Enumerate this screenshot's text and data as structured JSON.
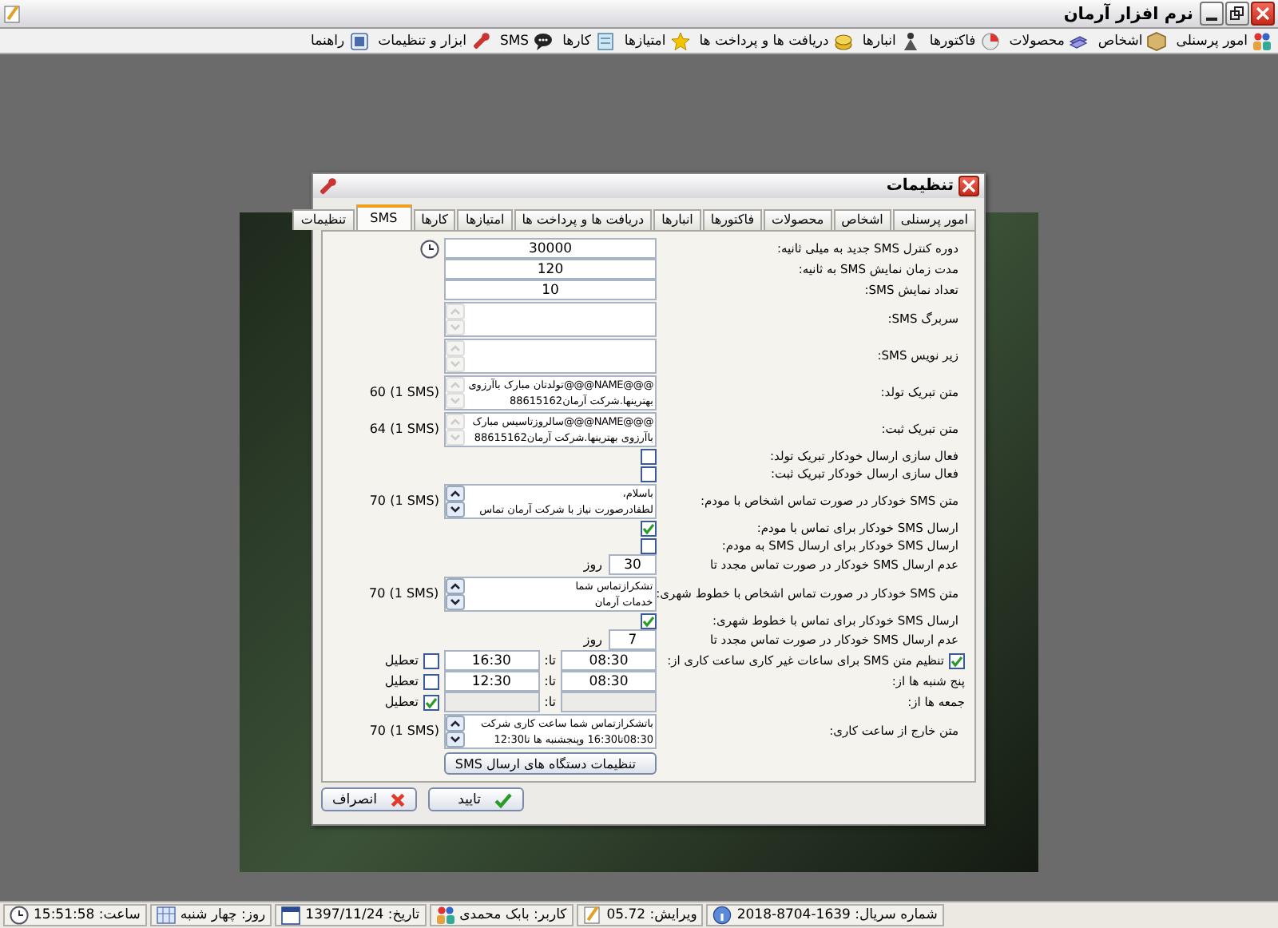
{
  "window": {
    "title": "نرم افزار آرمان"
  },
  "menu": [
    {
      "label": "امور پرسنلی"
    },
    {
      "label": "اشخاص"
    },
    {
      "label": "محصولات"
    },
    {
      "label": "فاکتورها"
    },
    {
      "label": "انبارها"
    },
    {
      "label": "دریافت ها و پرداخت ها"
    },
    {
      "label": "امتیازها"
    },
    {
      "label": "کارها"
    },
    {
      "label": "SMS"
    },
    {
      "label": "ابزار و تنظیمات"
    },
    {
      "label": "راهنما"
    }
  ],
  "dialog": {
    "title": "تنظیمات",
    "tabs": [
      {
        "label": "امور پرسنلی",
        "selected": false
      },
      {
        "label": "اشخاص",
        "selected": false
      },
      {
        "label": "محصولات",
        "selected": false
      },
      {
        "label": "فاکتورها",
        "selected": false
      },
      {
        "label": "انبارها",
        "selected": false
      },
      {
        "label": "دریافت ها و پرداخت ها",
        "selected": false
      },
      {
        "label": "امتیازها",
        "selected": false
      },
      {
        "label": "کارها",
        "selected": false
      },
      {
        "label": "SMS",
        "selected": true
      },
      {
        "label": "تنظیمات",
        "selected": false
      }
    ],
    "rows": [
      {
        "kind": "timer",
        "label": "دوره کنترل SMS جدید به میلی ثانیه:",
        "value": "30000"
      },
      {
        "kind": "number",
        "label": "مدت زمان نمایش SMS به ثانیه:",
        "value": "120"
      },
      {
        "kind": "number",
        "label": "تعداد نمایش SMS:",
        "value": "10"
      },
      {
        "kind": "memo",
        "label": "سربرگ SMS:",
        "lines": [],
        "scrollable": false
      },
      {
        "kind": "memo",
        "label": "زیر نویس SMS:",
        "lines": [],
        "scrollable": false
      },
      {
        "kind": "memo",
        "label": "متن تبریک تولد:",
        "lines": [
          "@@@NAME@@@تولدتان مبارک باآرزوی",
          "بهترینها.شرکت آرمان88615162"
        ],
        "count": "60 (1 SMS)",
        "scrollable": false
      },
      {
        "kind": "memo",
        "label": "متن تبریک ثبت:",
        "lines": [
          "@@@NAME@@@سالروزتاسیس مبارک",
          "باآرزوی بهترینها.شرکت آرمان88615162"
        ],
        "count": "64 (1 SMS)",
        "scrollable": false
      },
      {
        "kind": "check",
        "label": "فعال سازی ارسال خودکار تبریک تولد:",
        "checked": false
      },
      {
        "kind": "check",
        "label": "فعال سازی ارسال خودکار تبریک ثبت:",
        "checked": false
      },
      {
        "kind": "memo",
        "label": "متن SMS خودکار در صورت تماس اشخاص با مودم:",
        "lines": [
          "باسلام،",
          "لطفادرصورت نیاز با شرکت آرمان تماس"
        ],
        "count": "70 (1 SMS)",
        "scrollable": true
      },
      {
        "kind": "check",
        "label": "ارسال SMS خودکار برای تماس با مودم:",
        "checked": true
      },
      {
        "kind": "check",
        "label": "ارسال SMS خودکار برای ارسال SMS به مودم:",
        "checked": false
      },
      {
        "kind": "days",
        "label": "عدم ارسال SMS خودکار در صورت تماس مجدد تا",
        "value": "30",
        "unit": "روز"
      },
      {
        "kind": "memo",
        "label": "متن SMS خودکار در صورت تماس اشخاص با خطوط شهری:",
        "lines": [
          "تشکرازتماس شما",
          "خدمات آرمان"
        ],
        "count": "70 (1 SMS)",
        "scrollable": true
      },
      {
        "kind": "check",
        "label": "ارسال SMS خودکار برای تماس با خطوط شهری:",
        "checked": true
      },
      {
        "kind": "days",
        "label": "عدم ارسال SMS خودکار در صورت تماس مجدد تا",
        "value": "7",
        "unit": "روز"
      },
      {
        "kind": "hours",
        "label": "تنظیم متن SMS برای ساعات غیر کاری ساعت کاری از:",
        "checked": true,
        "from": "08:30",
        "to_label": "تا:",
        "to": "16:30",
        "closed_label": "تعطیل",
        "closed": false,
        "disabled": false
      },
      {
        "kind": "hours",
        "label": "پنج شنبه ها از:",
        "from": "08:30",
        "to_label": "تا:",
        "to": "12:30",
        "closed_label": "تعطیل",
        "closed": false,
        "disabled": false
      },
      {
        "kind": "hours",
        "label": "جمعه ها از:",
        "to_label": "تا:",
        "closed_label": "تعطیل",
        "closed": true,
        "disabled": true
      },
      {
        "kind": "memo",
        "label": "متن خارج از ساعت کاری:",
        "lines": [
          "باتشکرازتماس شما ساعت کاری شرکت",
          "08:30تا16:30 وپنجشنبه ها تا12:30"
        ],
        "count": "70 (1 SMS)",
        "scrollable": true
      },
      {
        "kind": "button",
        "label": "تنظیمات دستگاه های ارسال SMS"
      }
    ],
    "buttons": [
      {
        "kind": "ok",
        "label": "تایید"
      },
      {
        "kind": "cancel",
        "label": "انصراف"
      }
    ]
  },
  "status_bar": [
    {
      "text": "شماره سریال: 1639-8704-2018"
    },
    {
      "text": "ویرایش: 05.72"
    },
    {
      "text": "کاربر: بابک محمدی"
    },
    {
      "text": "تاریخ: 1397/11/24"
    },
    {
      "text": "روز: چهار شنبه"
    },
    {
      "text": "ساعت: 15:51:58"
    }
  ]
}
